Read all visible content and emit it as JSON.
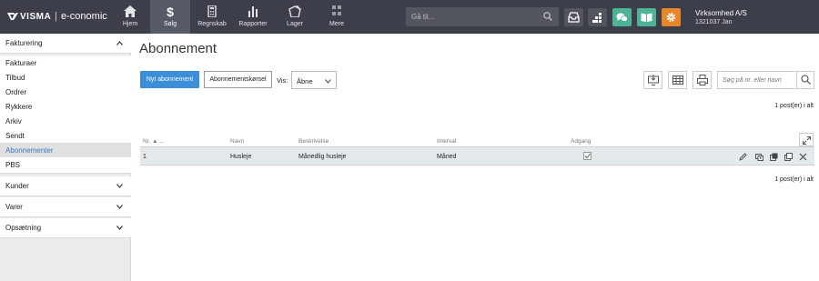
{
  "brand": {
    "logo_text": "VISMA",
    "separator": "|",
    "product": "e-conomic"
  },
  "nav": [
    {
      "label": "Hjem",
      "icon": "home-icon"
    },
    {
      "label": "Salg",
      "icon": "dollar-icon",
      "active": true
    },
    {
      "label": "Regnskab",
      "icon": "calculator-icon"
    },
    {
      "label": "Rapporter",
      "icon": "bar-chart-icon"
    },
    {
      "label": "Lager",
      "icon": "hanger-icon"
    },
    {
      "label": "Mere",
      "icon": "grid-icon"
    }
  ],
  "search": {
    "placeholder": "Gå til..."
  },
  "toolbar_icons": [
    {
      "name": "inbox-icon",
      "color": "#52545e"
    },
    {
      "name": "apps-icon",
      "color": "#52545e"
    },
    {
      "name": "chat-icon",
      "color": "#4db396"
    },
    {
      "name": "book-icon",
      "color": "#4db396"
    },
    {
      "name": "gear-icon",
      "color": "#e8862a"
    }
  ],
  "company": {
    "name": "Virksomhed A/S",
    "id_user": "1321037 Jan"
  },
  "sidebar": {
    "sections": [
      {
        "label": "Fakturering",
        "expanded": true,
        "items": [
          "Fakturaer",
          "Tilbud",
          "Ordrer",
          "Rykkere",
          "Arkiv",
          "Sendt",
          "Abonnementer",
          "PBS"
        ],
        "active_item": "Abonnementer"
      },
      {
        "label": "Kunder",
        "expanded": false
      },
      {
        "label": "Varer",
        "expanded": false
      },
      {
        "label": "Opsætning",
        "expanded": false
      }
    ]
  },
  "main": {
    "title": "Abonnement",
    "new_button": "Nyt abonnement",
    "run_button": "Abonnementskørsel",
    "vis_label": "Vis:",
    "vis_value": "Åbne",
    "grid_search_placeholder": "Søg på nr. eller navn",
    "count_text": "1 post(er) i alt",
    "columns": [
      "Nr.",
      "Navn",
      "Beskrivelse",
      "Interval",
      "Adgang"
    ],
    "sort_indicator": "▲ ...",
    "rows": [
      {
        "nr": "1",
        "navn": "Husleje",
        "beskrivelse": "Månedlig husleje",
        "interval": "Måned",
        "adgang": true
      }
    ]
  },
  "colors": {
    "topbar": "#3c3e49",
    "primary": "#3b8fd9",
    "active_link": "#3a79c9"
  }
}
